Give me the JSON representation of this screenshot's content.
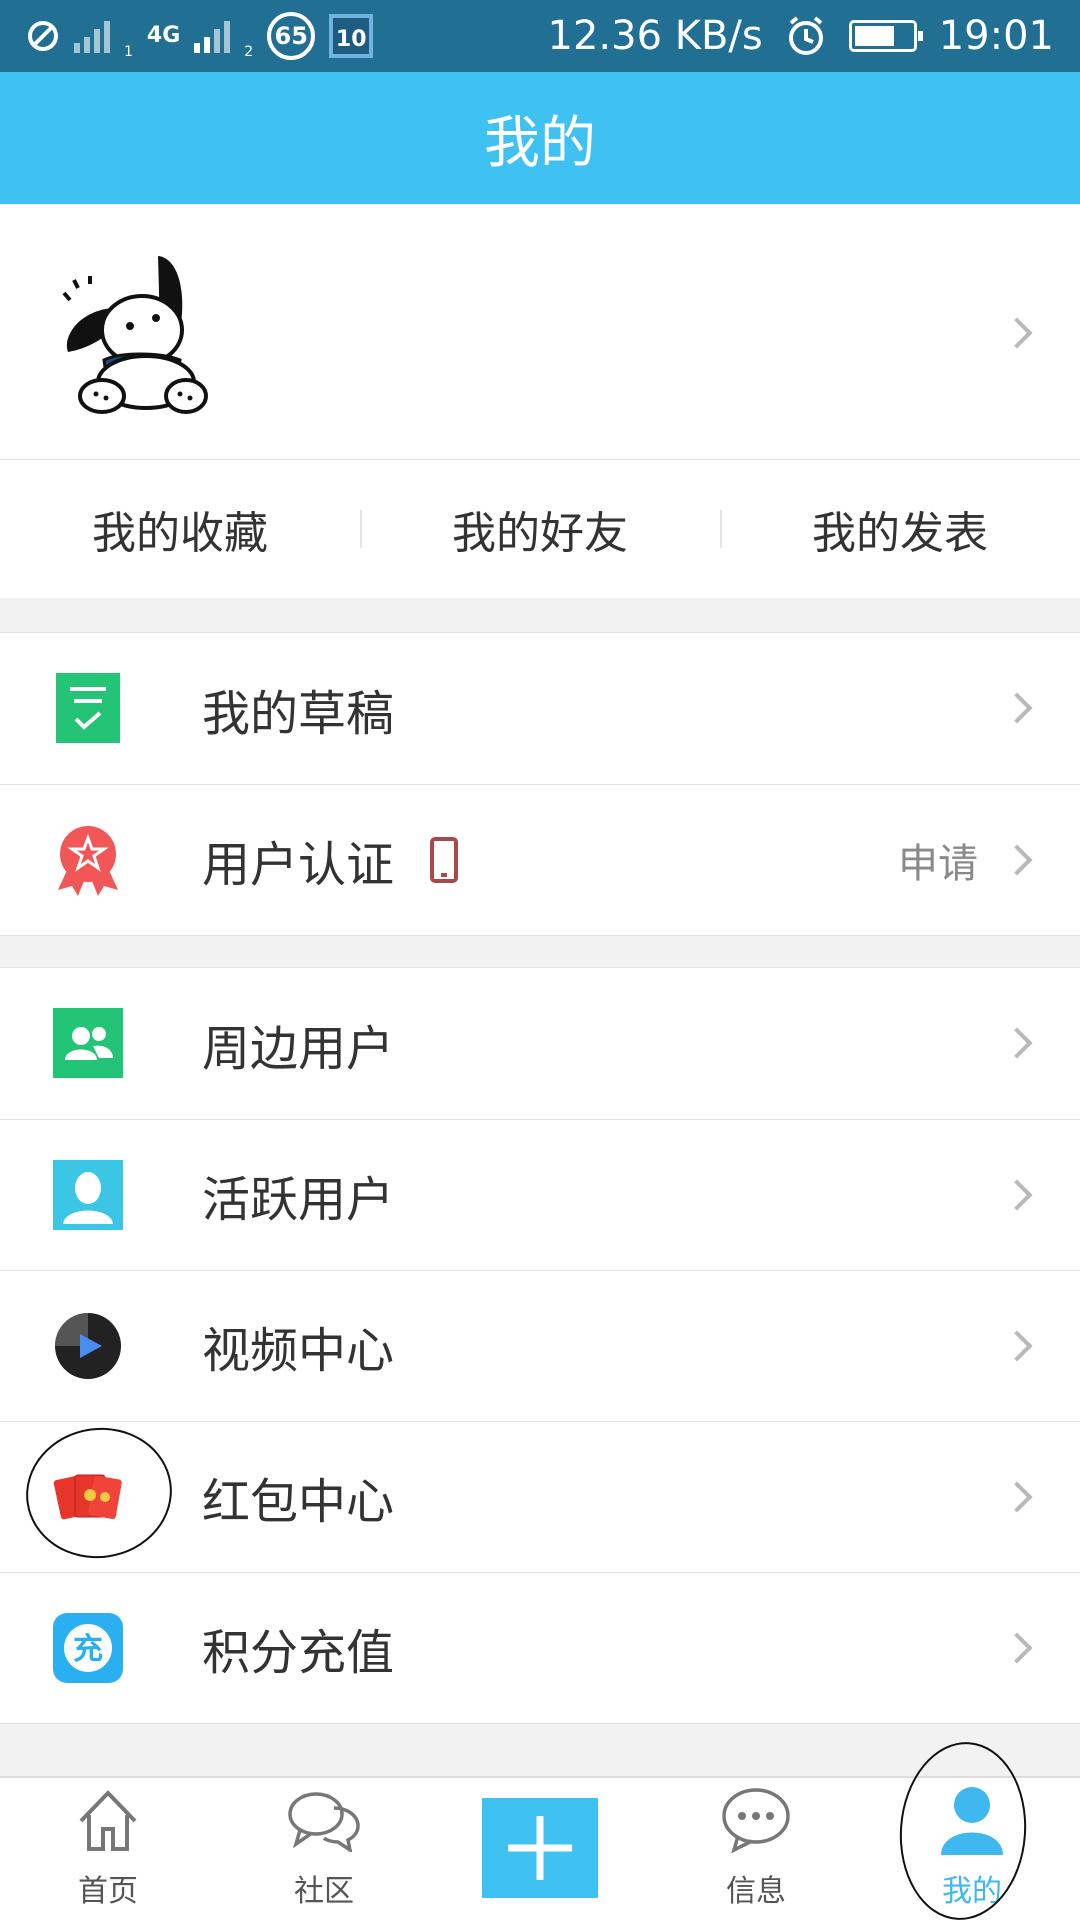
{
  "status_bar": {
    "network_type": "4G",
    "sim1": "1",
    "sim2": "2",
    "notification_count": "65",
    "calendar_day": "10",
    "speed": "12.36 KB/s",
    "time": "19:01",
    "battery_level": 0.7
  },
  "header": {
    "title": "我的"
  },
  "profile": {
    "avatar_icon": "pochacco-dog-avatar"
  },
  "quick_links": [
    {
      "label": "我的收藏"
    },
    {
      "label": "我的好友"
    },
    {
      "label": "我的发表"
    }
  ],
  "menu_group_1": [
    {
      "label": "我的草稿",
      "icon": "draft-icon",
      "color": "#23c475"
    },
    {
      "label": "用户认证",
      "icon": "badge-star-icon",
      "color": "#f25757",
      "extra": "申请"
    }
  ],
  "menu_group_2": [
    {
      "label": "周边用户",
      "icon": "nearby-users-icon",
      "color": "#23c475"
    },
    {
      "label": "活跃用户",
      "icon": "active-user-icon",
      "color": "#3cc6e6"
    },
    {
      "label": "视频中心",
      "icon": "video-play-icon",
      "color": "#222222"
    },
    {
      "label": "红包中心",
      "icon": "red-envelope-icon",
      "color": "#e8352b"
    },
    {
      "label": "积分充值",
      "icon": "recharge-icon",
      "color": "#2ab0f0"
    }
  ],
  "recharge_icon_text": "充",
  "bottom_nav": [
    {
      "label": "首页",
      "icon": "home-icon"
    },
    {
      "label": "社区",
      "icon": "community-chat-icon"
    },
    {
      "label": "",
      "icon": "plus-icon"
    },
    {
      "label": "信息",
      "icon": "message-icon"
    },
    {
      "label": "我的",
      "icon": "user-icon",
      "active": true
    }
  ],
  "colors": {
    "status_bar": "#226f94",
    "header": "#3fc1f2",
    "active_tab": "#3fb8ef"
  }
}
